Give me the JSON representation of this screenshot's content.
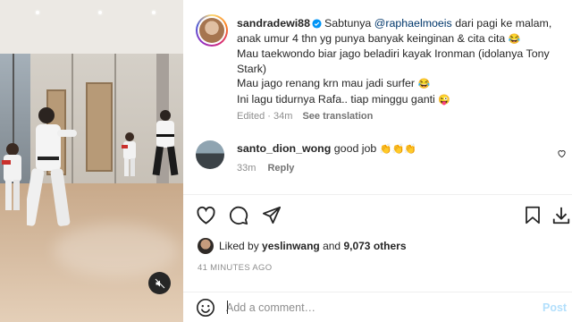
{
  "post": {
    "author": "sandradewi88",
    "verified": true,
    "caption_lines": [
      {
        "parts": [
          {
            "text": "Sabtunya "
          },
          {
            "text": "@raphaelmoeis",
            "mention": true
          },
          {
            "text": " dari pagi ke malam,"
          }
        ]
      },
      {
        "parts": [
          {
            "text": "anak umur 4 thn yg punya banyak keinginan & cita cita "
          },
          {
            "text": "😂",
            "emoji": true
          }
        ]
      },
      {
        "parts": [
          {
            "text": "Mau taekwondo biar jago beladiri kayak Ironman (idolanya Tony"
          }
        ]
      },
      {
        "parts": [
          {
            "text": "Stark)"
          }
        ]
      },
      {
        "parts": [
          {
            "text": "Mau jago renang krn mau jadi surfer "
          },
          {
            "text": "😂",
            "emoji": true
          }
        ]
      },
      {
        "parts": [
          {
            "text": "Ini lagu tidurnya Rafa.. tiap minggu ganti "
          },
          {
            "text": "😜",
            "emoji": true
          }
        ]
      }
    ],
    "edited_label": "Edited",
    "time": "34m",
    "see_translation": "See translation"
  },
  "comments": [
    {
      "user": "santo_dion_wong",
      "text": "good job",
      "emoji": "👏👏👏",
      "time": "33m",
      "reply_label": "Reply"
    }
  ],
  "actions": {
    "like_icon": "heart-icon",
    "comment_icon": "comment-icon",
    "share_icon": "share-icon",
    "save_icon": "bookmark-icon",
    "download_icon": "download-icon"
  },
  "likes": {
    "prefix": "Liked by",
    "first_liker": "yeslinwang",
    "conjunction": "and",
    "others_count": "9,073 others"
  },
  "time_ago": "41 MINUTES AGO",
  "comment_box": {
    "placeholder": "Add a comment…",
    "post_label": "Post"
  },
  "media": {
    "muted": true,
    "mute_icon": "speaker-muted-icon"
  },
  "colors": {
    "accent": "#0095f6",
    "post_disabled": "#b2dffc",
    "mention": "#00376b",
    "secondary_text": "#8e8e8e"
  }
}
